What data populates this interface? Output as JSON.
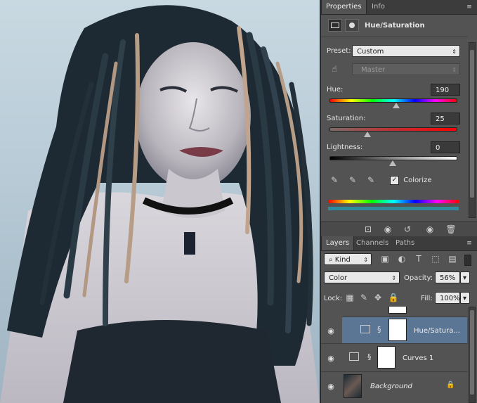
{
  "properties_panel": {
    "tabs": [
      {
        "label": "Properties"
      },
      {
        "label": "Info"
      }
    ],
    "adjustment_title": "Hue/Saturation",
    "preset_label": "Preset:",
    "preset_value": "Custom",
    "channel_value": "Master",
    "hue": {
      "label": "Hue:",
      "value": "190",
      "slider_level": 0.53
    },
    "saturation": {
      "label": "Saturation:",
      "value": "25",
      "slider_level": 0.3
    },
    "lightness": {
      "label": "Lightness:",
      "value": "0",
      "slider_level": 0.5
    },
    "colorize": {
      "label": "Colorize",
      "checked": true
    },
    "colorize_tint_color": "#2f8c9c"
  },
  "layers_panel": {
    "tabs": [
      {
        "label": "Layers"
      },
      {
        "label": "Channels"
      },
      {
        "label": "Paths"
      }
    ],
    "filter_kind": "Kind",
    "blend_mode": "Color",
    "opacity_label": "Opacity:",
    "opacity_value": "56%",
    "lock_label": "Lock:",
    "fill_label": "Fill:",
    "fill_value": "100%",
    "layers": [
      {
        "name": "Hue/Satura...",
        "type": "hue-saturation",
        "visible": true,
        "selected": true
      },
      {
        "name": "Curves 1",
        "type": "curves",
        "visible": true,
        "selected": false
      },
      {
        "name": "Background",
        "type": "image",
        "visible": true,
        "selected": false,
        "locked": true
      }
    ]
  },
  "colors": {
    "panel_bg": "#535353",
    "selected_layer": "#5b7594"
  }
}
